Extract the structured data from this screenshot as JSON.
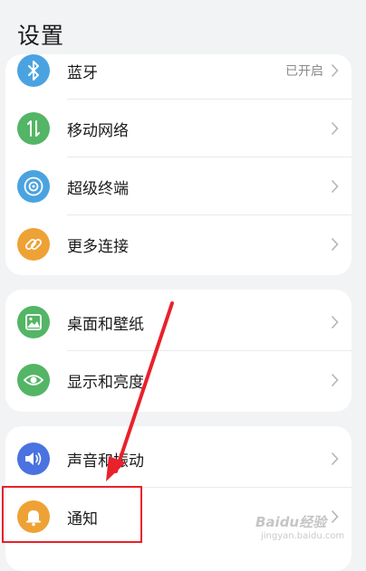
{
  "header": {
    "title": "设置"
  },
  "groups": [
    {
      "items": [
        {
          "label": "蓝牙",
          "value": "已开启",
          "icon": "bluetooth-icon",
          "color": "#4aa3e0"
        },
        {
          "label": "移动网络",
          "icon": "mobile-data-icon",
          "color": "#53b565"
        },
        {
          "label": "超级终端",
          "icon": "super-device-icon",
          "color": "#4aa3e0"
        },
        {
          "label": "更多连接",
          "icon": "link-icon",
          "color": "#eea235"
        }
      ]
    },
    {
      "items": [
        {
          "label": "桌面和壁纸",
          "icon": "wallpaper-icon",
          "color": "#53b565"
        },
        {
          "label": "显示和亮度",
          "icon": "eye-icon",
          "color": "#53b565"
        }
      ]
    },
    {
      "items": [
        {
          "label": "声音和振动",
          "icon": "volume-icon",
          "color": "#4a72e0"
        },
        {
          "label": "通知",
          "icon": "bell-icon",
          "color": "#eea235"
        }
      ]
    }
  ],
  "annotation": {
    "highlight_color": "#e8212b"
  },
  "watermark": {
    "text": "Baidu经验",
    "sub": "jingyan.baidu.com"
  }
}
